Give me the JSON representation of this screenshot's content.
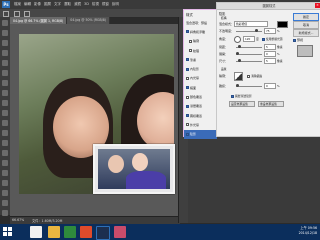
{
  "app": {
    "logo": "Ps"
  },
  "menus": [
    "檔案",
    "編輯",
    "影像",
    "圖層",
    "文字",
    "選取",
    "濾鏡",
    "3D",
    "檢視",
    "視窗",
    "說明"
  ],
  "tabs": [
    {
      "label": "04.jpg @ 66.7% (圖層 1, RGB/8)",
      "active": true
    },
    {
      "label": "04.jpg @ 50% (RGB/8)",
      "active": false
    }
  ],
  "status": {
    "zoom": "66.67%",
    "doc": "文件：1.60M/3.20M"
  },
  "layer_style": {
    "title": "樣式",
    "items": [
      {
        "label": "混合選項：預設",
        "checked": false
      },
      {
        "label": "斜角和浮雕",
        "checked": true
      },
      {
        "label": "輪廓",
        "checked": false
      },
      {
        "label": "紋理",
        "checked": false
      },
      {
        "label": "筆畫",
        "checked": true
      },
      {
        "label": "內陰影",
        "checked": true
      },
      {
        "label": "內光暈",
        "checked": false
      },
      {
        "label": "緞面",
        "checked": true
      },
      {
        "label": "顏色覆蓋",
        "checked": false
      },
      {
        "label": "漸層覆蓋",
        "checked": true
      },
      {
        "label": "圖樣覆蓋",
        "checked": true
      },
      {
        "label": "外光暈",
        "checked": false
      },
      {
        "label": "陰影",
        "checked": true,
        "selected": true
      }
    ]
  },
  "dialog": {
    "title": "圖層樣式",
    "close": "✕",
    "section1": "陰影",
    "sub1": "結構",
    "blend_mode_label": "混合模式：",
    "blend_mode_value": "色彩增值",
    "opacity_label": "不透明度：",
    "opacity_value": "75",
    "angle_label": "角度：",
    "angle_value": "120",
    "global_light": "使用整體光源",
    "distance_label": "間距：",
    "distance_value": "5",
    "spread_label": "展開：",
    "spread_value": "0",
    "size_label": "尺寸：",
    "size_value": "5",
    "section2": "品質",
    "contour_label": "輪廓：",
    "antialias": "消除鋸齒",
    "noise_label": "雜訊：",
    "noise_value": "0",
    "knockout": "圖層穿透陰影",
    "make_default": "設定為預設值",
    "reset_default": "重設為預設值",
    "px": "像素",
    "pct": "%",
    "deg": "度",
    "buttons": {
      "ok": "確定",
      "cancel": "取消",
      "new_style": "新增樣式...",
      "preview": "預視"
    }
  },
  "taskbar": {
    "time": "上午 09:56",
    "date": "2014/12/18"
  },
  "colors": {
    "selection": "#3a6bb8",
    "taskbar": "#0b2e5c",
    "highlight_border": "#e3b6e6"
  }
}
